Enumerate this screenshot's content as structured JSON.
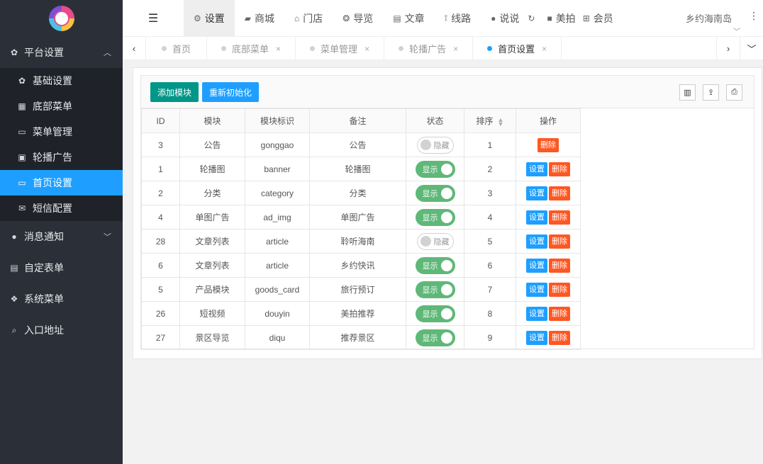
{
  "sidebar": {
    "groups": [
      {
        "label": "平台设置",
        "icon": "gear-icon",
        "open": true,
        "items": [
          {
            "label": "基础设置",
            "icon": "gear-icon"
          },
          {
            "label": "底部菜单",
            "icon": "grid-icon"
          },
          {
            "label": "菜单管理",
            "icon": "monitor-icon"
          },
          {
            "label": "轮播广告",
            "icon": "image-icon"
          },
          {
            "label": "首页设置",
            "icon": "monitor-icon",
            "active": true
          },
          {
            "label": "短信配置",
            "icon": "mail-icon"
          }
        ]
      },
      {
        "label": "消息通知",
        "icon": "chat-icon"
      },
      {
        "label": "自定表单",
        "icon": "form-icon"
      },
      {
        "label": "系统菜单",
        "icon": "cubes-icon"
      },
      {
        "label": "入口地址",
        "icon": "search-icon"
      }
    ]
  },
  "topbar": {
    "items": [
      {
        "label": "设置",
        "icon": "gears-icon",
        "active": true
      },
      {
        "label": "商城",
        "icon": "bag-icon"
      },
      {
        "label": "门店",
        "icon": "bank-icon"
      },
      {
        "label": "导览",
        "icon": "compass-icon"
      },
      {
        "label": "文章",
        "icon": "newspaper-icon"
      },
      {
        "label": "线路",
        "icon": "route-icon"
      },
      {
        "label": "说说",
        "icon": "chat-icon"
      },
      {
        "label": "",
        "icon": "refresh-icon"
      },
      {
        "label": "美拍",
        "icon": "video-icon"
      },
      {
        "label": "会员",
        "icon": "sitemap-icon"
      }
    ],
    "site_name": "乡约海南岛"
  },
  "tabs": [
    {
      "label": "首页",
      "closable": false
    },
    {
      "label": "底部菜单",
      "closable": true
    },
    {
      "label": "菜单管理",
      "closable": true
    },
    {
      "label": "轮播广告",
      "closable": true
    },
    {
      "label": "首页设置",
      "closable": true,
      "active": true
    }
  ],
  "toolbar": {
    "add_label": "添加模块",
    "reset_label": "重新初始化"
  },
  "table": {
    "headers": [
      "ID",
      "模块",
      "模块标识",
      "备注",
      "状态",
      "排序",
      "操作"
    ],
    "rows": [
      {
        "id": "3",
        "module": "公告",
        "key": "gonggao",
        "note": "公告",
        "status": "隐藏",
        "on": false,
        "sort": "1",
        "ops": [
          "删除"
        ]
      },
      {
        "id": "1",
        "module": "轮播图",
        "key": "banner",
        "note": "轮播图",
        "status": "显示",
        "on": true,
        "sort": "2",
        "ops": [
          "设置",
          "删除"
        ]
      },
      {
        "id": "2",
        "module": "分类",
        "key": "category",
        "note": "分类",
        "status": "显示",
        "on": true,
        "sort": "3",
        "ops": [
          "设置",
          "删除"
        ]
      },
      {
        "id": "4",
        "module": "单图广告",
        "key": "ad_img",
        "note": "单图广告",
        "status": "显示",
        "on": true,
        "sort": "4",
        "ops": [
          "设置",
          "删除"
        ]
      },
      {
        "id": "28",
        "module": "文章列表",
        "key": "article",
        "note": "聆听海南",
        "status": "隐藏",
        "on": false,
        "sort": "5",
        "ops": [
          "设置",
          "删除"
        ]
      },
      {
        "id": "6",
        "module": "文章列表",
        "key": "article",
        "note": "乡约快讯",
        "status": "显示",
        "on": true,
        "sort": "6",
        "ops": [
          "设置",
          "删除"
        ]
      },
      {
        "id": "5",
        "module": "产品模块",
        "key": "goods_card",
        "note": "旅行预订",
        "status": "显示",
        "on": true,
        "sort": "7",
        "ops": [
          "设置",
          "删除"
        ]
      },
      {
        "id": "26",
        "module": "短视频",
        "key": "douyin",
        "note": "美拍推荐",
        "status": "显示",
        "on": true,
        "sort": "8",
        "ops": [
          "设置",
          "删除"
        ]
      },
      {
        "id": "27",
        "module": "景区导览",
        "key": "diqu",
        "note": "推荐景区",
        "status": "显示",
        "on": true,
        "sort": "9",
        "ops": [
          "设置",
          "删除"
        ]
      }
    ]
  },
  "colors": {
    "sidebar_bg": "#2b3038",
    "active_blue": "#1e9fff",
    "add_green": "#009688",
    "switch_green": "#5fb878",
    "delete_orange": "#ff5722"
  }
}
